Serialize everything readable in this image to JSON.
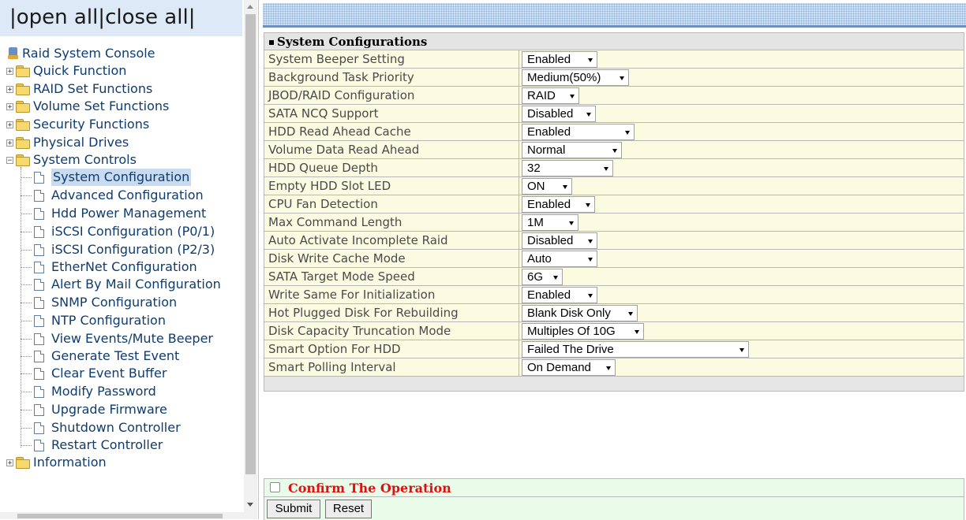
{
  "tree": {
    "open_all": "open all",
    "close_all": "close all",
    "root": "Raid System Console",
    "folders": [
      "Quick Function",
      "RAID Set Functions",
      "Volume Set Functions",
      "Security Functions",
      "Physical Drives",
      "System Controls"
    ],
    "system_controls_items": [
      "System Configuration",
      "Advanced Configuration",
      "Hdd Power Management",
      "iSCSI Configuration (P0/1)",
      "iSCSI Configuration (P2/3)",
      "EtherNet Configuration",
      "Alert By Mail Configuration",
      "SNMP Configuration",
      "NTP Configuration",
      "View Events/Mute Beeper",
      "Generate Test Event",
      "Clear Event Buffer",
      "Modify Password",
      "Upgrade Firmware",
      "Shutdown Controller",
      "Restart Controller"
    ],
    "last_folder": "Information",
    "selected": "System Configuration"
  },
  "config": {
    "title": "System Configurations",
    "rows": [
      {
        "label": "System Beeper Setting",
        "value": "Enabled"
      },
      {
        "label": "Background Task Priority",
        "value": "Medium(50%)"
      },
      {
        "label": "JBOD/RAID Configuration",
        "value": "RAID"
      },
      {
        "label": "SATA NCQ Support",
        "value": "Disabled"
      },
      {
        "label": "HDD Read Ahead Cache",
        "value": "Enabled"
      },
      {
        "label": "Volume Data Read Ahead",
        "value": "Normal"
      },
      {
        "label": "HDD Queue Depth",
        "value": "32"
      },
      {
        "label": "Empty HDD Slot LED",
        "value": "ON"
      },
      {
        "label": "CPU Fan Detection",
        "value": "Enabled"
      },
      {
        "label": "Max Command Length",
        "value": "1M"
      },
      {
        "label": "Auto Activate Incomplete Raid",
        "value": "Disabled"
      },
      {
        "label": "Disk Write Cache Mode",
        "value": "Auto"
      },
      {
        "label": "SATA Target Mode Speed",
        "value": "6G"
      },
      {
        "label": "Write Same For Initialization",
        "value": "Enabled"
      },
      {
        "label": "Hot Plugged Disk For Rebuilding",
        "value": "Blank Disk Only"
      },
      {
        "label": "Disk Capacity Truncation Mode",
        "value": "Multiples Of 10G"
      },
      {
        "label": "Smart Option For HDD",
        "value": "Failed The Drive"
      },
      {
        "label": "Smart Polling Interval",
        "value": "On Demand"
      }
    ]
  },
  "confirm": {
    "label": "Confirm The Operation",
    "checked": false
  },
  "buttons": {
    "submit": "Submit",
    "reset": "Reset"
  },
  "colors": {
    "confirm_text": "#e01010",
    "row_bg": "#fbfbe2",
    "confirm_bg": "#e9fbe9",
    "tree_text": "#0f3c6e"
  }
}
